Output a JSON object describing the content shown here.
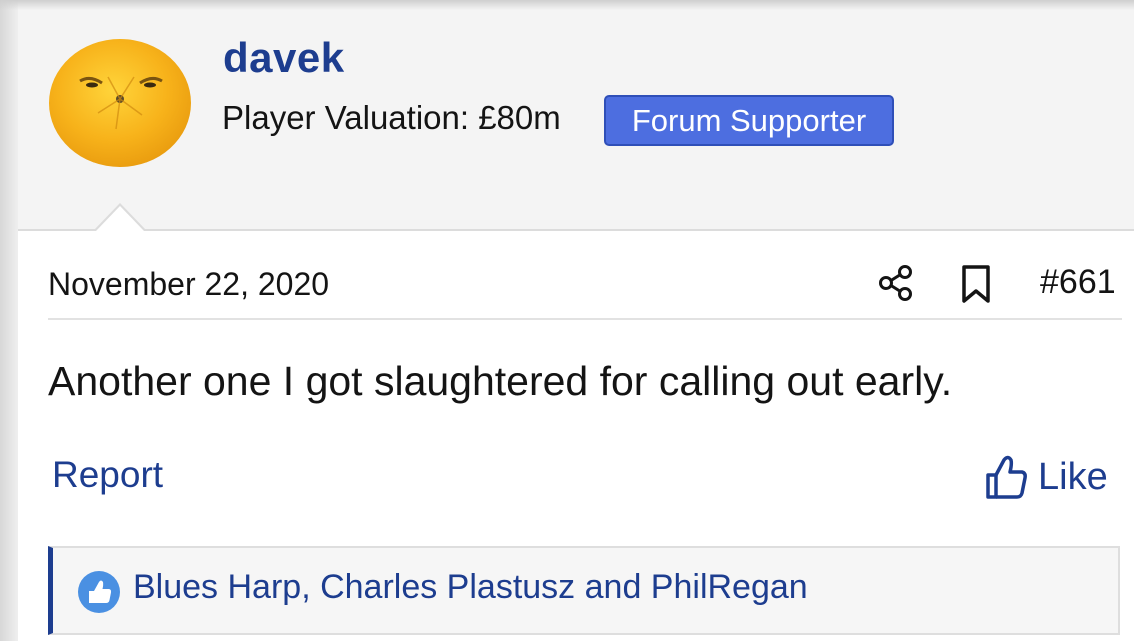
{
  "user": {
    "name": "davek",
    "valuation": "Player Valuation: £80m",
    "badge": "Forum Supporter"
  },
  "post": {
    "date": "November 22, 2020",
    "number": "#661",
    "body": "Another one I got slaughtered for calling out early.",
    "report_label": "Report",
    "like_label": "Like",
    "reactions_text": "Blues Harp, Charles Plastusz and PhilRegan"
  },
  "icons": {
    "share": "share-icon",
    "bookmark": "bookmark-icon",
    "like": "thumbs-up-icon",
    "reaction": "like-reaction-icon"
  },
  "colors": {
    "link": "#1d3d8f",
    "badge": "#4d6ee0",
    "header_bg": "#f4f4f4"
  }
}
